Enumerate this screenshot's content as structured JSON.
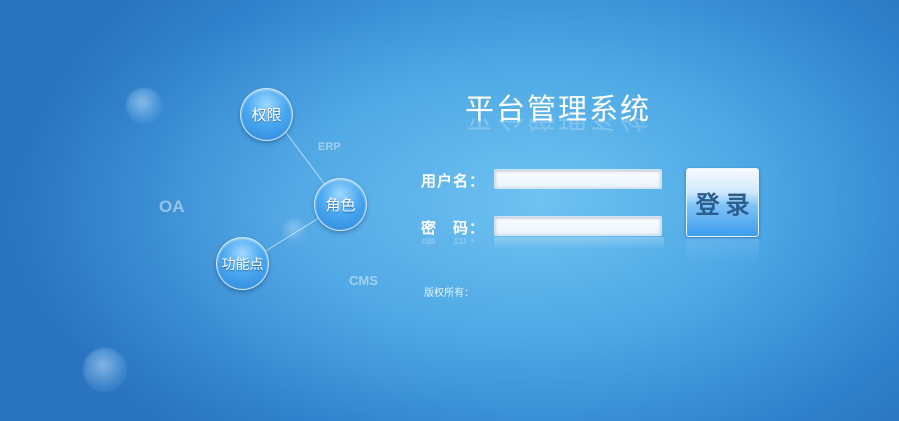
{
  "page": {
    "title": "平台管理系统"
  },
  "diagram": {
    "nodes": {
      "permission": "权限",
      "role": "角色",
      "function_point": "功能点"
    },
    "floating_labels": {
      "erp": "ERP",
      "oa": "OA",
      "cms": "CMS"
    }
  },
  "login_form": {
    "username_label": "用户名：",
    "password_label": "密　码：",
    "username_value": "",
    "password_value": "",
    "login_button_label": "登录"
  },
  "footer": {
    "copyright": "版权所有："
  },
  "colors": {
    "background_center": "#6ec3f2",
    "background_edge": "#2a74bf",
    "node_fill": "#4aa8f0",
    "button_text": "#2a5e8f"
  }
}
